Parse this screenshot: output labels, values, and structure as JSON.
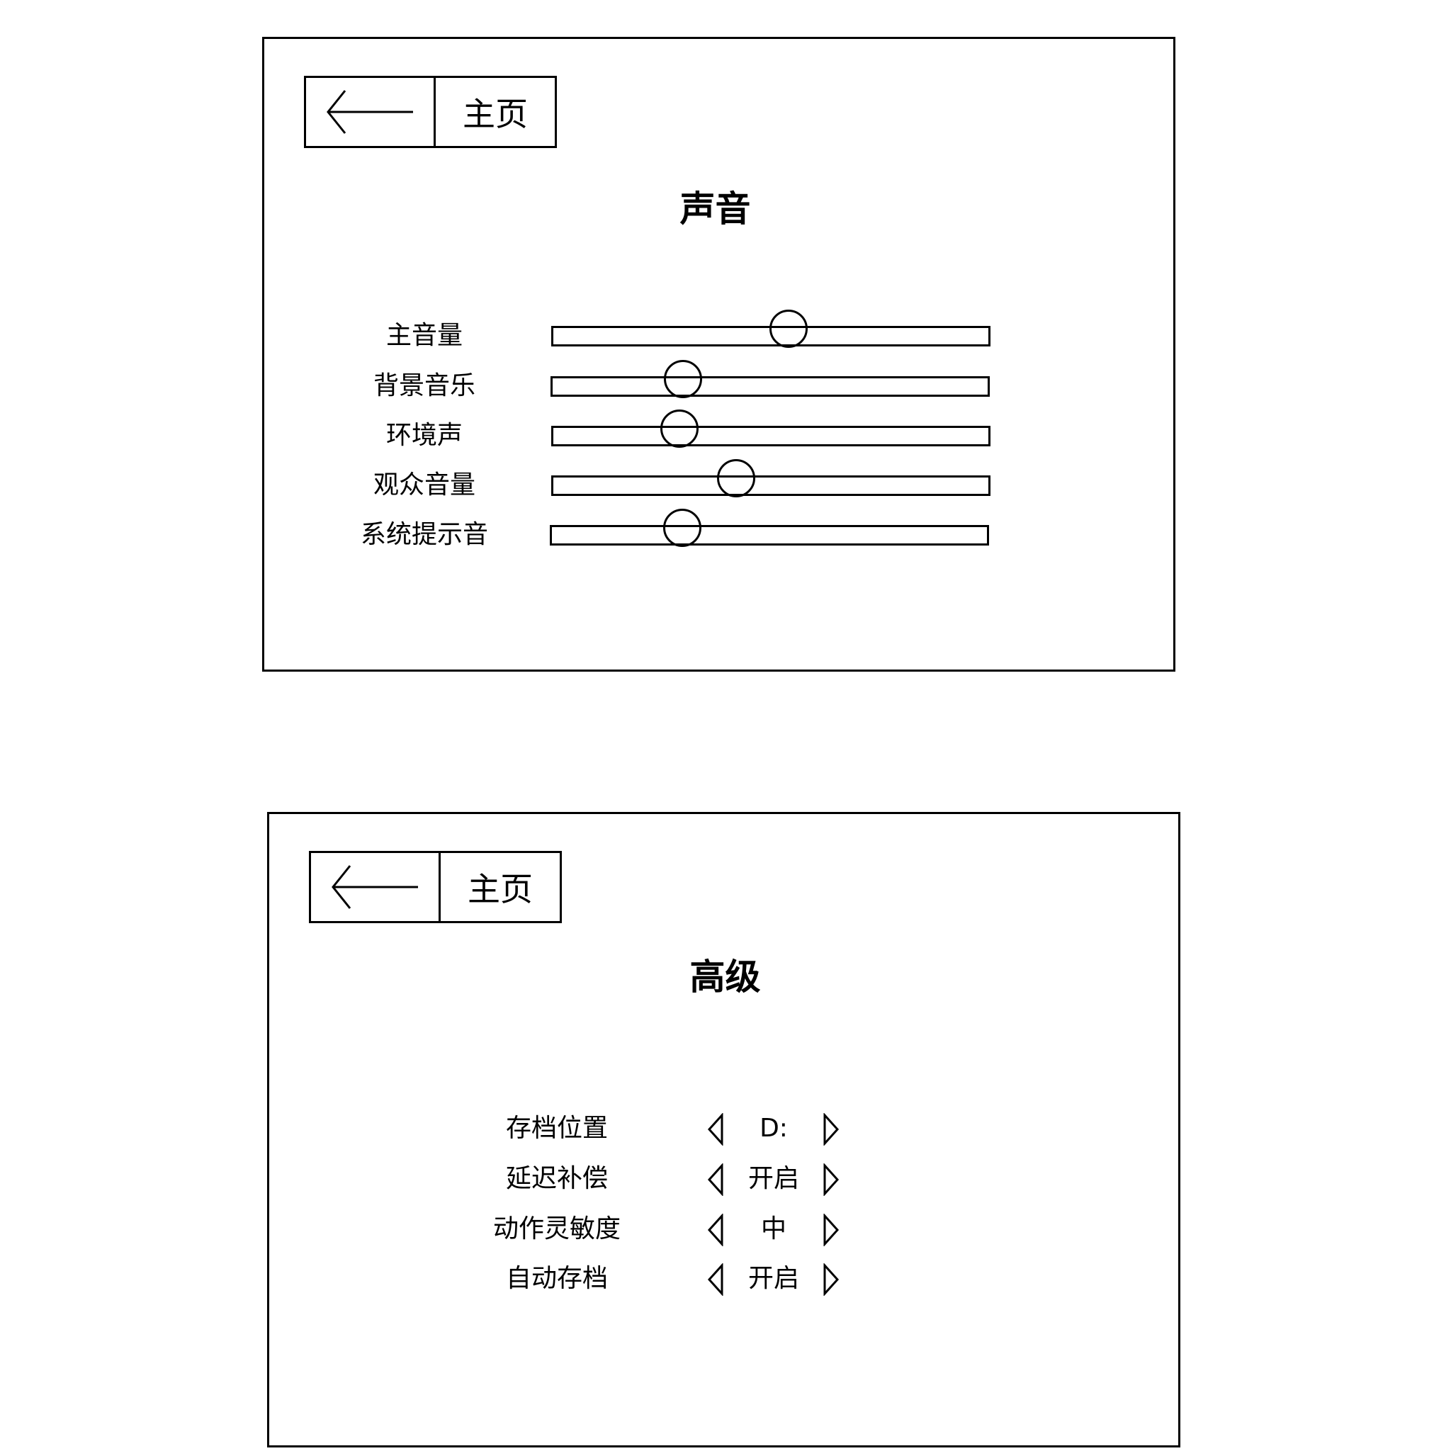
{
  "sound_screen": {
    "back_icon": "arrow-left-icon",
    "home_label": "主页",
    "title": "声音",
    "sliders": [
      {
        "label": "主音量",
        "value": 0.54
      },
      {
        "label": "背景音乐",
        "value": 0.3
      },
      {
        "label": "环境声",
        "value": 0.29
      },
      {
        "label": "观众音量",
        "value": 0.42
      },
      {
        "label": "系统提示音",
        "value": 0.3
      }
    ]
  },
  "advanced_screen": {
    "back_icon": "arrow-left-icon",
    "home_label": "主页",
    "title": "高级",
    "options": [
      {
        "label": "存档位置",
        "value": "D:"
      },
      {
        "label": "延迟补偿",
        "value": "开启"
      },
      {
        "label": "动作灵敏度",
        "value": "中"
      },
      {
        "label": "自动存档",
        "value": "开启"
      }
    ]
  }
}
